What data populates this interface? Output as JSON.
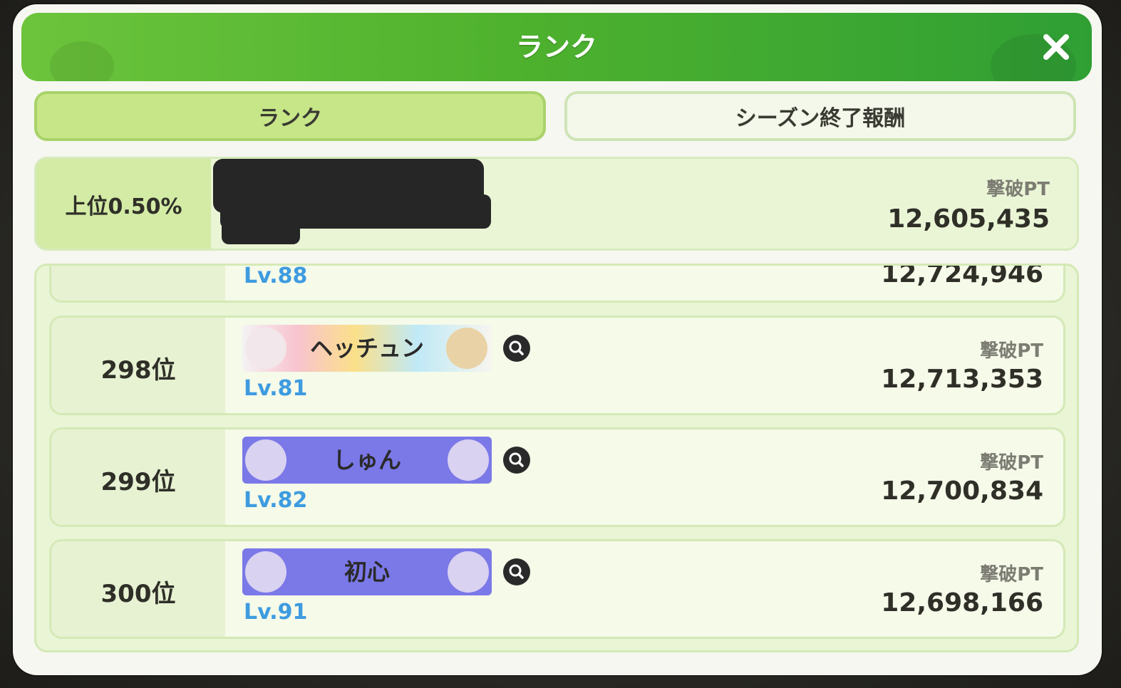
{
  "header": {
    "title": "ランク"
  },
  "tabs": [
    {
      "label": "ランク",
      "active": true
    },
    {
      "label": "シーズン終了報酬",
      "active": false
    }
  ],
  "my_rank": {
    "percentile": "上位0.50%",
    "points_label": "撃破PT",
    "points": "12,605,435"
  },
  "partial_row": {
    "level": "Lv.88",
    "points": "12,724,946"
  },
  "rows": [
    {
      "rank": "298位",
      "name": "ヘッチュン",
      "level": "Lv.81",
      "points_label": "撃破PT",
      "points": "12,713,353"
    },
    {
      "rank": "299位",
      "name": "しゅん",
      "level": "Lv.82",
      "points_label": "撃破PT",
      "points": "12,700,834"
    },
    {
      "rank": "300位",
      "name": "初心",
      "level": "Lv.91",
      "points_label": "撃破PT",
      "points": "12,698,166"
    }
  ],
  "icons": {
    "close": "close-icon",
    "profile": "magnifier-icon"
  },
  "colors": {
    "header_green": "#4fb22e",
    "level_blue": "#3e9be0",
    "tab_active": "#c6e688"
  }
}
